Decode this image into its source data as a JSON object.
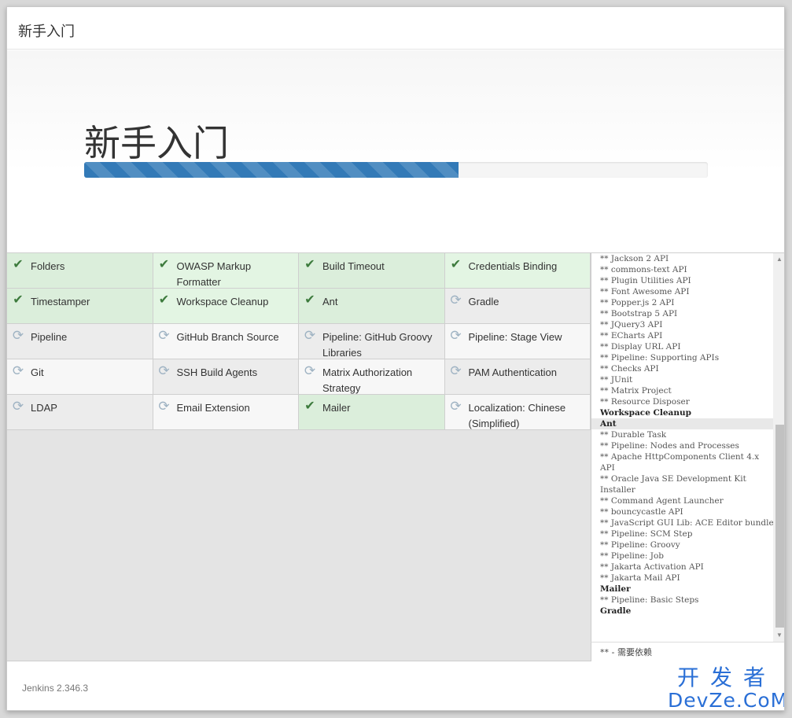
{
  "window": {
    "title": "新手入门"
  },
  "hero": {
    "title": "新手入门",
    "progress": 0.6
  },
  "plugins": [
    {
      "name": "Folders",
      "status": "success"
    },
    {
      "name": "OWASP Markup Formatter",
      "status": "success"
    },
    {
      "name": "Build Timeout",
      "status": "success"
    },
    {
      "name": "Credentials Binding",
      "status": "success"
    },
    {
      "name": "Timestamper",
      "status": "success"
    },
    {
      "name": "Workspace Cleanup",
      "status": "success"
    },
    {
      "name": "Ant",
      "status": "success"
    },
    {
      "name": "Gradle",
      "status": "pending"
    },
    {
      "name": "Pipeline",
      "status": "pending"
    },
    {
      "name": "GitHub Branch Source",
      "status": "pending"
    },
    {
      "name": "Pipeline: GitHub Groovy Libraries",
      "status": "pending"
    },
    {
      "name": "Pipeline: Stage View",
      "status": "pending"
    },
    {
      "name": "Git",
      "status": "pending"
    },
    {
      "name": "SSH Build Agents",
      "status": "pending"
    },
    {
      "name": "Matrix Authorization Strategy",
      "status": "pending"
    },
    {
      "name": "PAM Authentication",
      "status": "pending"
    },
    {
      "name": "LDAP",
      "status": "pending"
    },
    {
      "name": "Email Extension",
      "status": "pending"
    },
    {
      "name": "Mailer",
      "status": "success"
    },
    {
      "name": "Localization: Chinese (Simplified)",
      "status": "pending"
    }
  ],
  "log": {
    "lines": [
      {
        "text": "** Jackson 2 API",
        "bold": false
      },
      {
        "text": "** commons-text API",
        "bold": false
      },
      {
        "text": "** Plugin Utilities API",
        "bold": false
      },
      {
        "text": "** Font Awesome API",
        "bold": false
      },
      {
        "text": "** Popper.js 2 API",
        "bold": false
      },
      {
        "text": "** Bootstrap 5 API",
        "bold": false
      },
      {
        "text": "** JQuery3 API",
        "bold": false
      },
      {
        "text": "** ECharts API",
        "bold": false
      },
      {
        "text": "** Display URL API",
        "bold": false
      },
      {
        "text": "** Pipeline: Supporting APIs",
        "bold": false
      },
      {
        "text": "** Checks API",
        "bold": false
      },
      {
        "text": "** JUnit",
        "bold": false
      },
      {
        "text": "** Matrix Project",
        "bold": false
      },
      {
        "text": "** Resource Disposer",
        "bold": false
      },
      {
        "text": "Workspace Cleanup",
        "bold": true
      },
      {
        "text": "Ant",
        "bold": true,
        "highlight": true
      },
      {
        "text": "** Durable Task",
        "bold": false
      },
      {
        "text": "** Pipeline: Nodes and Processes",
        "bold": false
      },
      {
        "text": "** Apache HttpComponents Client 4.x API",
        "bold": false
      },
      {
        "text": "** Oracle Java SE Development Kit Installer",
        "bold": false
      },
      {
        "text": "** Command Agent Launcher",
        "bold": false
      },
      {
        "text": "** bouncycastle API",
        "bold": false
      },
      {
        "text": "** JavaScript GUI Lib: ACE Editor bundle",
        "bold": false
      },
      {
        "text": "** Pipeline: SCM Step",
        "bold": false
      },
      {
        "text": "** Pipeline: Groovy",
        "bold": false
      },
      {
        "text": "** Pipeline: Job",
        "bold": false
      },
      {
        "text": "** Jakarta Activation API",
        "bold": false
      },
      {
        "text": "** Jakarta Mail API",
        "bold": false
      },
      {
        "text": "Mailer",
        "bold": true
      },
      {
        "text": "** Pipeline: Basic Steps",
        "bold": false
      },
      {
        "text": "Gradle",
        "bold": true
      }
    ],
    "footer": "** - 需要依赖"
  },
  "footer": {
    "version": "Jenkins 2.346.3",
    "watermark_top": "开发者",
    "watermark_bottom": "DevZe.CoM"
  },
  "colors": {
    "accent": "#337ab7",
    "success_bg": "#dbeedb",
    "check": "#3d7b3d",
    "watermark": "#2a6fd6"
  },
  "icons": {
    "success": "check-icon",
    "pending": "refresh-icon"
  }
}
